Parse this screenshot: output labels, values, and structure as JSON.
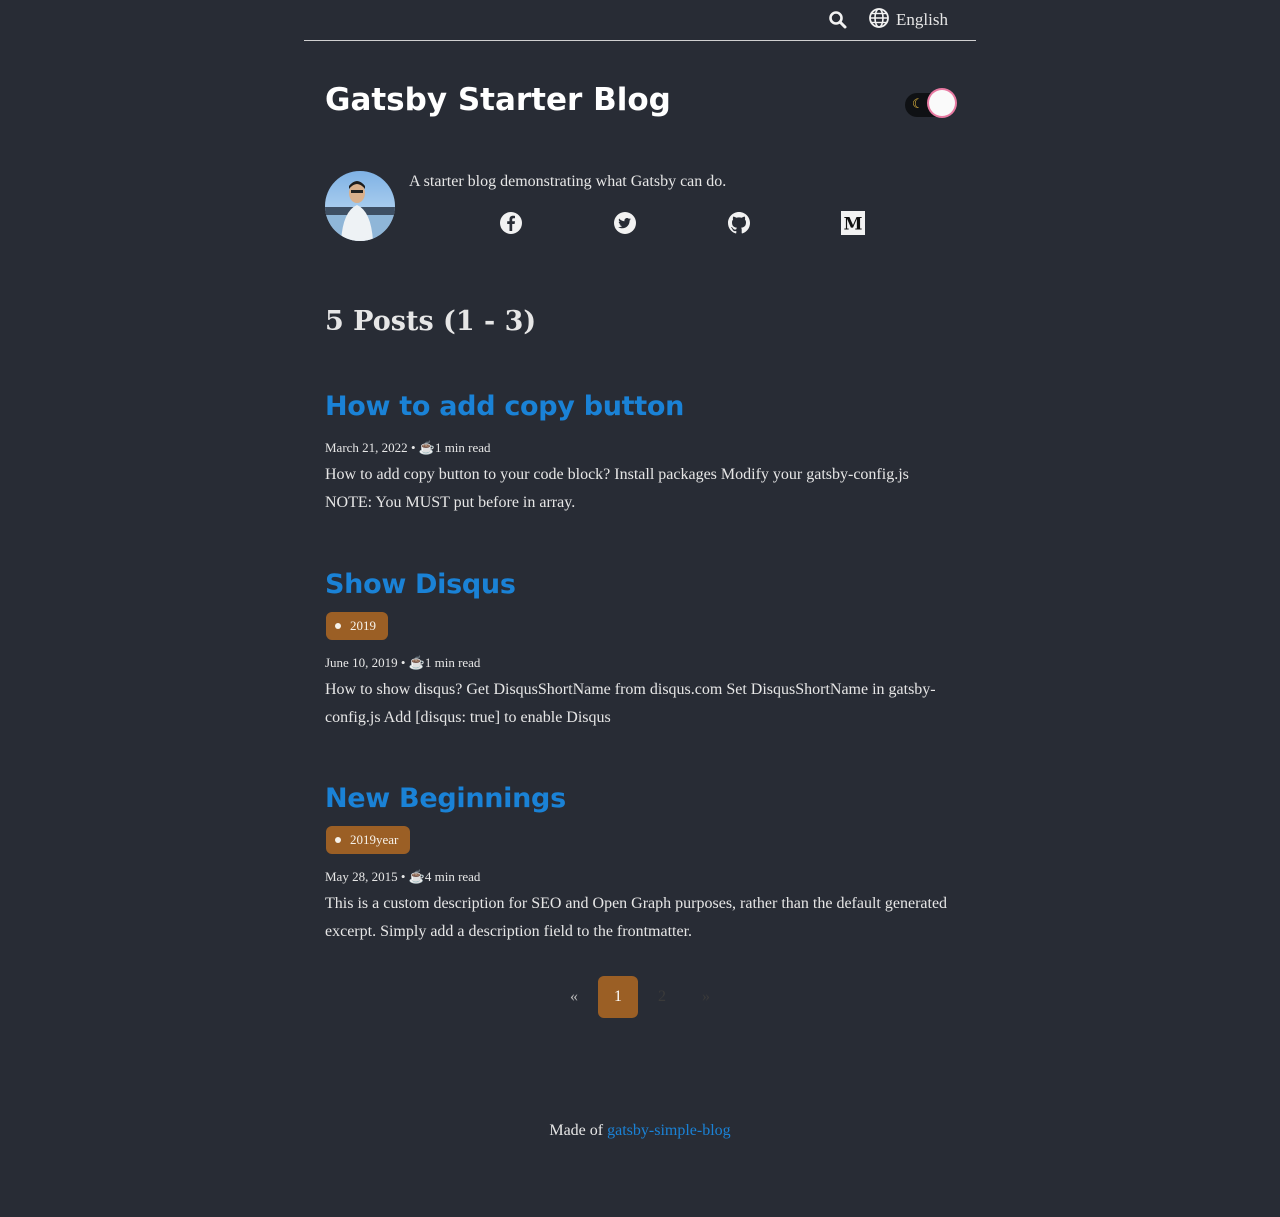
{
  "topbar": {
    "language_label": "English"
  },
  "header": {
    "blog_title": "Gatsby Starter Blog",
    "theme_toggle_icon": "moon-icon"
  },
  "bio": {
    "description": "A starter blog demonstrating what Gatsby can do.",
    "socials": [
      "facebook-icon",
      "twitter-icon",
      "github-icon",
      "medium-icon"
    ]
  },
  "posts_heading": "5 Posts (1 - 3)",
  "posts": [
    {
      "title": "How to add copy button",
      "tag": null,
      "date": "March 21, 2022",
      "read_time": "1 min read",
      "excerpt_lines": [
        "How to add copy button to your code block? Install packages Modify your gatsby-config.js",
        "NOTE: You MUST put before in array."
      ]
    },
    {
      "title": "Show Disqus",
      "tag": "2019",
      "date": "June 10, 2019",
      "read_time": "1 min read",
      "excerpt_lines": [
        "How to show disqus? Get DisqusShortName from disqus.com Set DisqusShortName in gatsby-",
        "config.js Add [disqus: true] to enable Disqus"
      ]
    },
    {
      "title": "New Beginnings",
      "tag": "2019year",
      "date": "May 28, 2015",
      "read_time": "4 min read",
      "excerpt_lines": [
        "This is a custom description for SEO and Open Graph purposes, rather than the default generated",
        "excerpt. Simply add a description field to the frontmatter."
      ]
    }
  ],
  "pagination": {
    "prev": "«",
    "pages": [
      "1",
      "2"
    ],
    "current": "1",
    "next": "»"
  },
  "footer": {
    "prefix": "Made of",
    "link_text": "gatsby-simple-blog"
  },
  "colors": {
    "background": "#282c35",
    "link": "#1a82d6",
    "tag": "#9b5f25"
  }
}
